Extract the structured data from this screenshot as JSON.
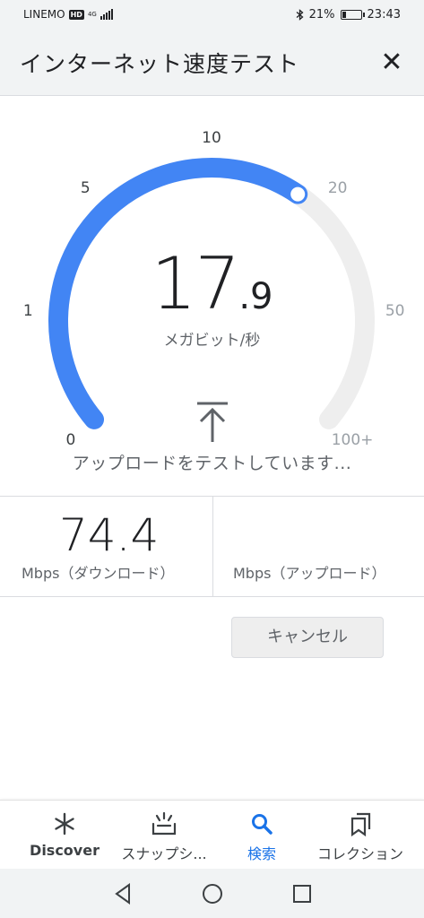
{
  "status_bar": {
    "carrier": "LINEMO",
    "hd_badge": "HD",
    "network": "4G",
    "bluetooth": "bluetooth-icon",
    "battery_percent": "21%",
    "battery_level": 0.21,
    "time": "23:43"
  },
  "header": {
    "title": "インターネット速度テスト",
    "close_icon": "close-icon"
  },
  "gauge": {
    "scale_labels": [
      "0",
      "1",
      "5",
      "10",
      "20",
      "50",
      "100+"
    ],
    "current_value": 17.9,
    "accent_color": "#4285f4",
    "track_color": "#eeeeee"
  },
  "speed": {
    "integer": "17",
    "decimal": ".9",
    "unit": "メガビット/秒"
  },
  "status_text": "アップロードをテストしています...",
  "results": {
    "download_value": "74.4",
    "download_label": "Mbps（ダウンロード）",
    "upload_value": "",
    "upload_label": "Mbps（アップロード）"
  },
  "cancel_label": "キャンセル",
  "bottom_nav": {
    "discover": "Discover",
    "snapshot": "スナップシ...",
    "search": "検索",
    "collections": "コレクション",
    "active_color": "#1a73e8"
  }
}
